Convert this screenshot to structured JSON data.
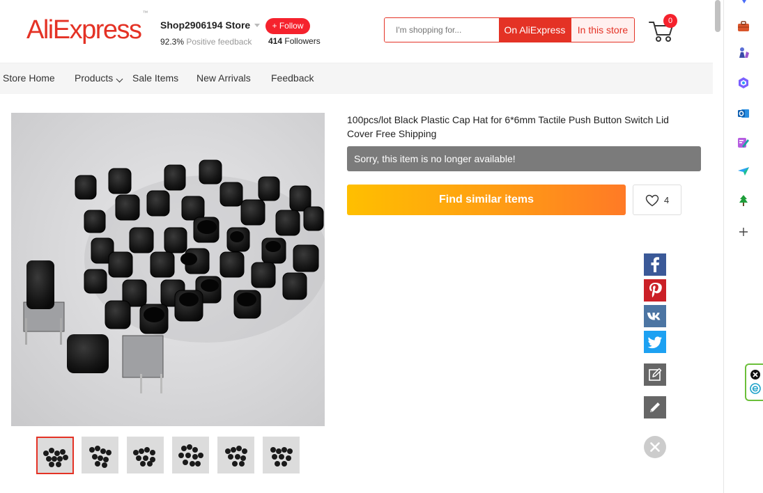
{
  "header": {
    "logo_text": "AliExpress",
    "logo_mark": "™",
    "store_name": "Shop2906194 Store",
    "follow_label": "+ Follow",
    "feedback_percent": "92.3%",
    "feedback_label": "Positive feedback",
    "followers_count": "414",
    "followers_label": "Followers",
    "search_placeholder": "I'm shopping for...",
    "search_on_ali": "On AliExpress",
    "search_in_store": "In this store",
    "cart_count": "0"
  },
  "nav": {
    "items": [
      "Store Home",
      "Products",
      "Sale Items",
      "New Arrivals",
      "Feedback"
    ]
  },
  "product": {
    "title": "100pcs/lot Black Plastic Cap Hat for 6*6mm Tactile Push Button Switch Lid Cover Free Shipping",
    "unavailable_text": "Sorry, this item is no longer available!",
    "find_similar_label": "Find similar items",
    "wishlist_count": "4",
    "thumbnail_count": 6,
    "active_thumbnail": 1
  },
  "share": {
    "icons": [
      "facebook-icon",
      "pinterest-icon",
      "vk-icon",
      "twitter-icon",
      "edit-icon",
      "pencil-icon",
      "close-icon"
    ]
  },
  "colors": {
    "brand_red": "#e43225",
    "find_gradient_start": "#ffbf00",
    "find_gradient_end": "#ff7a26",
    "unavailable_bg": "#7b7b7b",
    "facebook": "#3b5998",
    "pinterest": "#cb2027",
    "vk": "#4c75a3",
    "twitter": "#1da1f2",
    "tool_gray": "#666666"
  },
  "sidebar": {
    "icons": [
      "briefcase-icon",
      "chess-icon",
      "copilot-icon",
      "outlook-icon",
      "designer-icon",
      "paper-plane-icon",
      "tree-icon",
      "add-icon"
    ]
  }
}
